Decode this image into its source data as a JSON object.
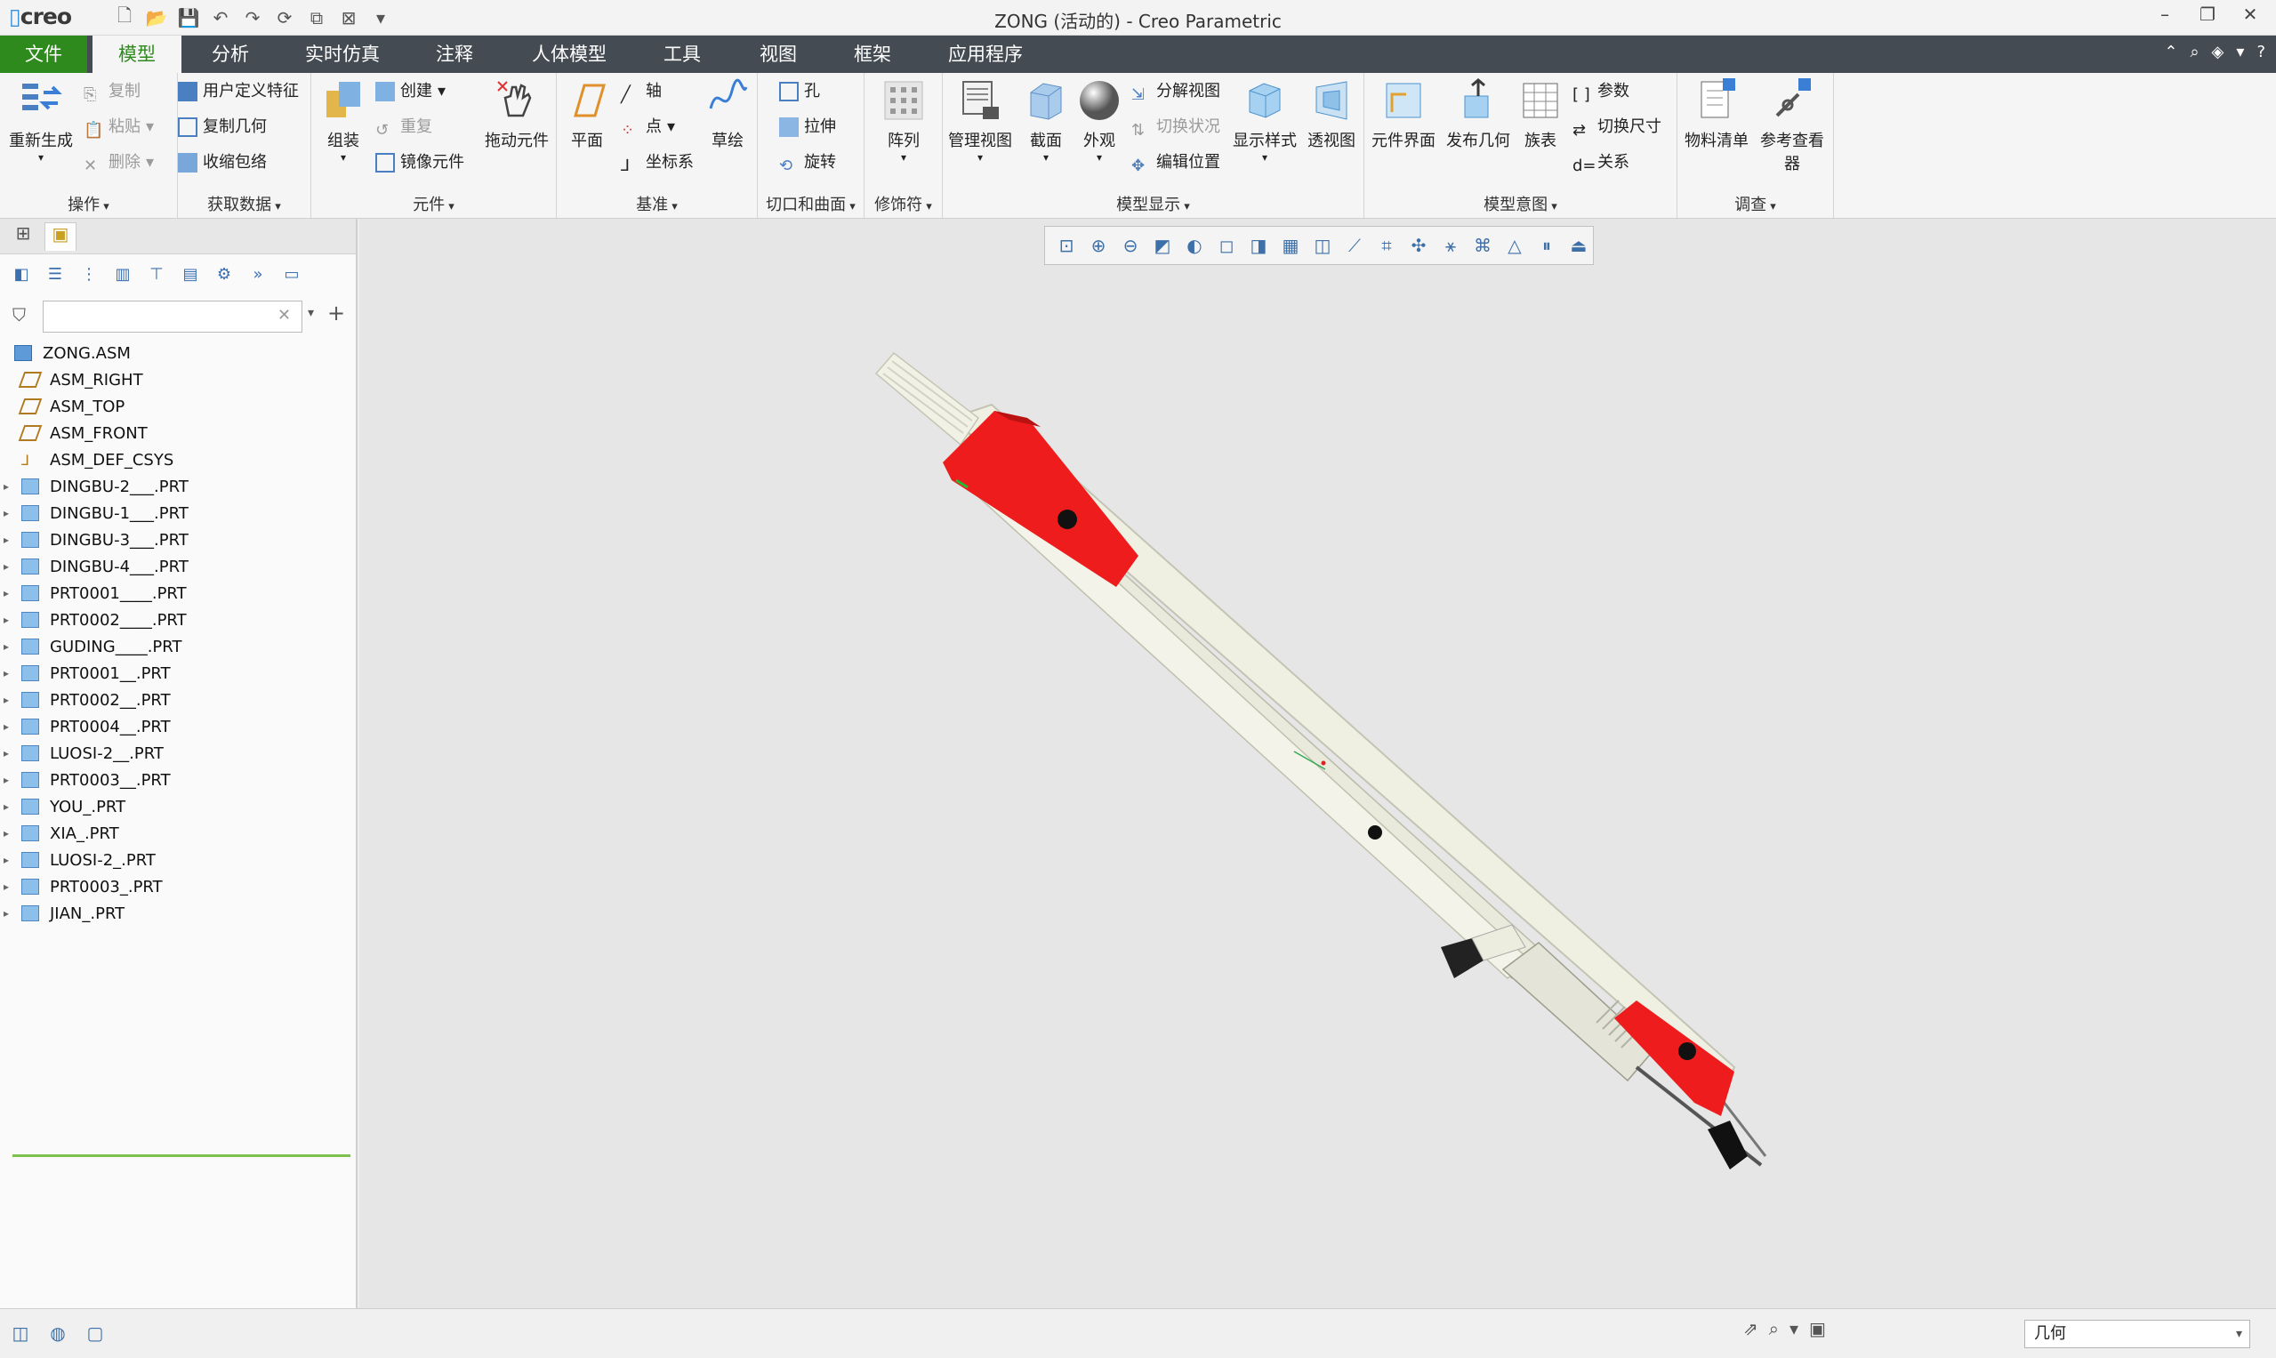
{
  "window": {
    "logo_text": "creo",
    "title": "ZONG (活动的) - Creo Parametric"
  },
  "ribbon_tabs": {
    "file": "文件",
    "model": "模型",
    "analysis": "分析",
    "simulation": "实时仿真",
    "annotate": "注释",
    "manikin": "人体模型",
    "tools": "工具",
    "view": "视图",
    "framework": "框架",
    "applications": "应用程序"
  },
  "ribbon": {
    "operations": {
      "label": "操作",
      "regenerate": "重新生成",
      "copy": "复制",
      "paste": "粘贴",
      "delete": "删除"
    },
    "get_data": {
      "label": "获取数据",
      "udf": "用户定义特征",
      "copy_geom": "复制几何",
      "shrinkwrap": "收缩包络"
    },
    "component": {
      "label": "元件",
      "assemble": "组装",
      "create": "创建",
      "repeat": "重复",
      "mirror": "镜像元件",
      "drag": "拖动元件"
    },
    "datum": {
      "label": "基准",
      "plane": "平面",
      "axis": "轴",
      "point": "点",
      "csys": "坐标系",
      "sketch": "草绘"
    },
    "cut_surface": {
      "label": "切口和曲面",
      "hole": "孔",
      "extrude": "拉伸",
      "revolve": "旋转"
    },
    "modifiers": {
      "label": "修饰符",
      "pattern": "阵列"
    },
    "model_display": {
      "label": "模型显示",
      "manage_views": "管理视图",
      "section": "截面",
      "appearance": "外观",
      "exploded": "分解视图",
      "toggle_status": "切换状况",
      "edit_position": "编辑位置",
      "display_style": "显示样式",
      "perspective": "透视图"
    },
    "model_intent": {
      "label": "模型意图",
      "component_interface": "元件界面",
      "publish_geom": "发布几何",
      "family_table": "族表",
      "parameters": "参数",
      "switch_dims": "切换尺寸",
      "relations": "关系"
    },
    "investigate": {
      "label": "调查",
      "bom": "物料清单",
      "ref_viewer_line1": "参考查看",
      "ref_viewer_line2": "器"
    }
  },
  "model_tree": {
    "filter_placeholder": "",
    "root": "ZONG.ASM",
    "datums": [
      "ASM_RIGHT",
      "ASM_TOP",
      "ASM_FRONT",
      "ASM_DEF_CSYS"
    ],
    "parts": [
      "DINGBU-2___.PRT",
      "DINGBU-1___.PRT",
      "DINGBU-3___.PRT",
      "DINGBU-4___.PRT",
      "PRT0001____.PRT",
      "PRT0002____.PRT",
      "GUDING____.PRT",
      "PRT0001__.PRT",
      "PRT0002__.PRT",
      "PRT0004__.PRT",
      "LUOSI-2__.PRT",
      "PRT0003__.PRT",
      "YOU_.PRT",
      "XIA_.PRT",
      "LUOSI-2_.PRT",
      "PRT0003_.PRT",
      "JIAN_.PRT"
    ]
  },
  "status_bar": {
    "selection_filter": "几何"
  },
  "colors": {
    "file_tab": "#2f8a1d",
    "tab_bar": "#444b52",
    "model_red": "#ee1c1c",
    "model_body": "#ededde"
  }
}
